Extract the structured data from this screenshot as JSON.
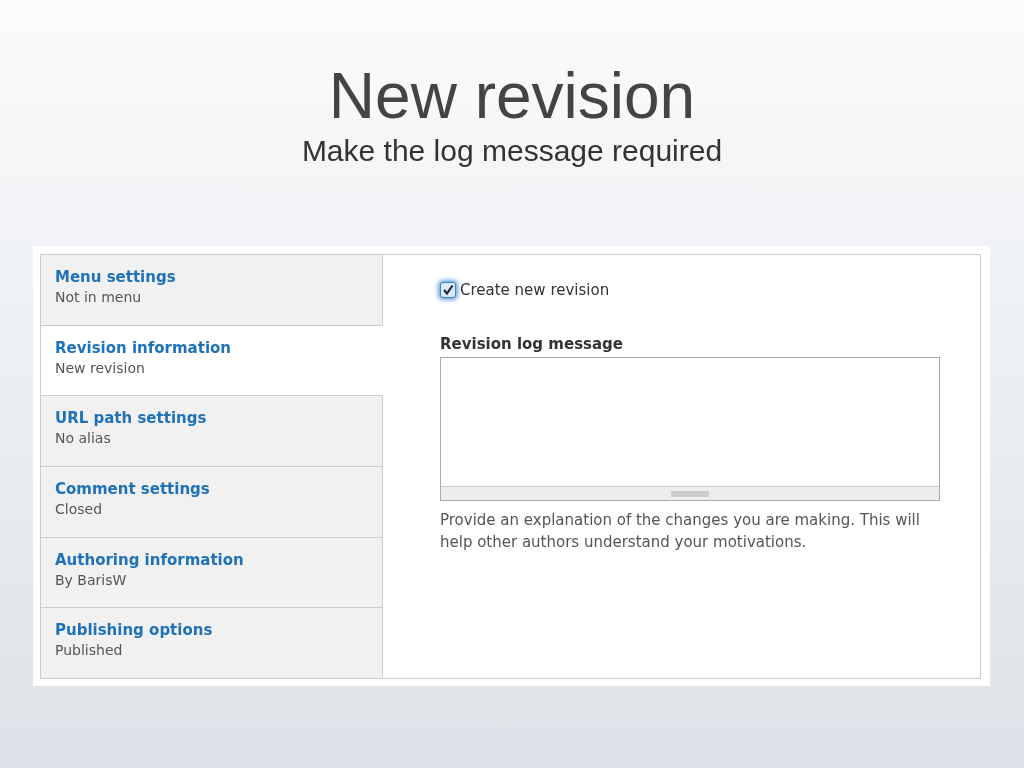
{
  "slide": {
    "title": "New revision",
    "subtitle": "Make the log message required"
  },
  "vertical_tabs": [
    {
      "title": "Menu settings",
      "summary": "Not in menu",
      "selected": false
    },
    {
      "title": "Revision information",
      "summary": "New revision",
      "selected": true
    },
    {
      "title": "URL path settings",
      "summary": "No alias",
      "selected": false
    },
    {
      "title": "Comment settings",
      "summary": "Closed",
      "selected": false
    },
    {
      "title": "Authoring information",
      "summary": "By BarisW",
      "selected": false
    },
    {
      "title": "Publishing options",
      "summary": "Published",
      "selected": false
    }
  ],
  "pane": {
    "checkbox": {
      "label": "Create new revision",
      "checked": true
    },
    "log_message": {
      "label": "Revision log message",
      "description": "Provide an explanation of the changes you are making. This will help other authors understand your motivations."
    }
  }
}
